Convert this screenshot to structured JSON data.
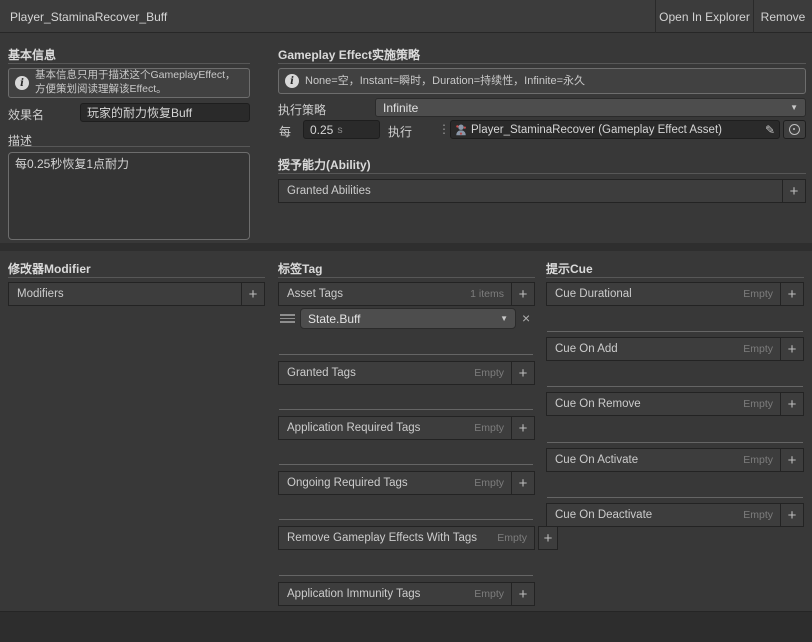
{
  "titlebar": {
    "title": "Player_StaminaRecover_Buff",
    "open_in_explorer": "Open In Explorer",
    "remove": "Remove"
  },
  "basic_info": {
    "header": "基本信息",
    "help": "基本信息只用于描述这个GameplayEffect，方便策划阅读理解该Effect。",
    "effect_name_label": "效果名",
    "effect_name_value": "玩家的耐力恢复Buff",
    "description_label": "描述",
    "description_value": "每0.25秒恢复1点耐力"
  },
  "implementation": {
    "header": "Gameplay Effect实施策略",
    "help": "None=空，Instant=瞬时，Duration=持续性，Infinite=永久",
    "policy_label": "执行策略",
    "policy_value": "Infinite",
    "every_label": "每",
    "interval_value": "0.25",
    "interval_unit": "s",
    "execute_label": "执行",
    "effect_asset": "Player_StaminaRecover (Gameplay Effect Asset)"
  },
  "granted_ability": {
    "header": "授予能力(Ability)",
    "list_label": "Granted Abilities"
  },
  "modifier": {
    "header": "修改器Modifier",
    "list_label": "Modifiers"
  },
  "tags": {
    "header": "标签Tag",
    "asset_tags": {
      "label": "Asset Tags",
      "count": "1 items",
      "item": "State.Buff"
    },
    "lists": [
      {
        "label": "Granted Tags",
        "badge": "Empty"
      },
      {
        "label": "Application Required Tags",
        "badge": "Empty"
      },
      {
        "label": "Ongoing Required Tags",
        "badge": "Empty"
      },
      {
        "label": "Remove Gameplay Effects With Tags",
        "badge": "Empty"
      },
      {
        "label": "Application Immunity Tags",
        "badge": "Empty"
      }
    ]
  },
  "cues": {
    "header": "提示Cue",
    "lists": [
      {
        "label": "Cue Durational",
        "badge": "Empty"
      },
      {
        "label": "Cue On Add",
        "badge": "Empty"
      },
      {
        "label": "Cue On Remove",
        "badge": "Empty"
      },
      {
        "label": "Cue On Activate",
        "badge": "Empty"
      },
      {
        "label": "Cue On Deactivate",
        "badge": "Empty"
      }
    ]
  },
  "icons": {
    "info": "i",
    "dropdown_arrow": "▼",
    "close": "×",
    "add": "+",
    "pencil": "✎",
    "more_dots": "⋮"
  },
  "colors": {
    "background": "#383838",
    "footer": "#2d2d2d",
    "field": "#2a2a2a",
    "dropdown": "#4d4d4d",
    "help_border": "#6d6d6d"
  }
}
